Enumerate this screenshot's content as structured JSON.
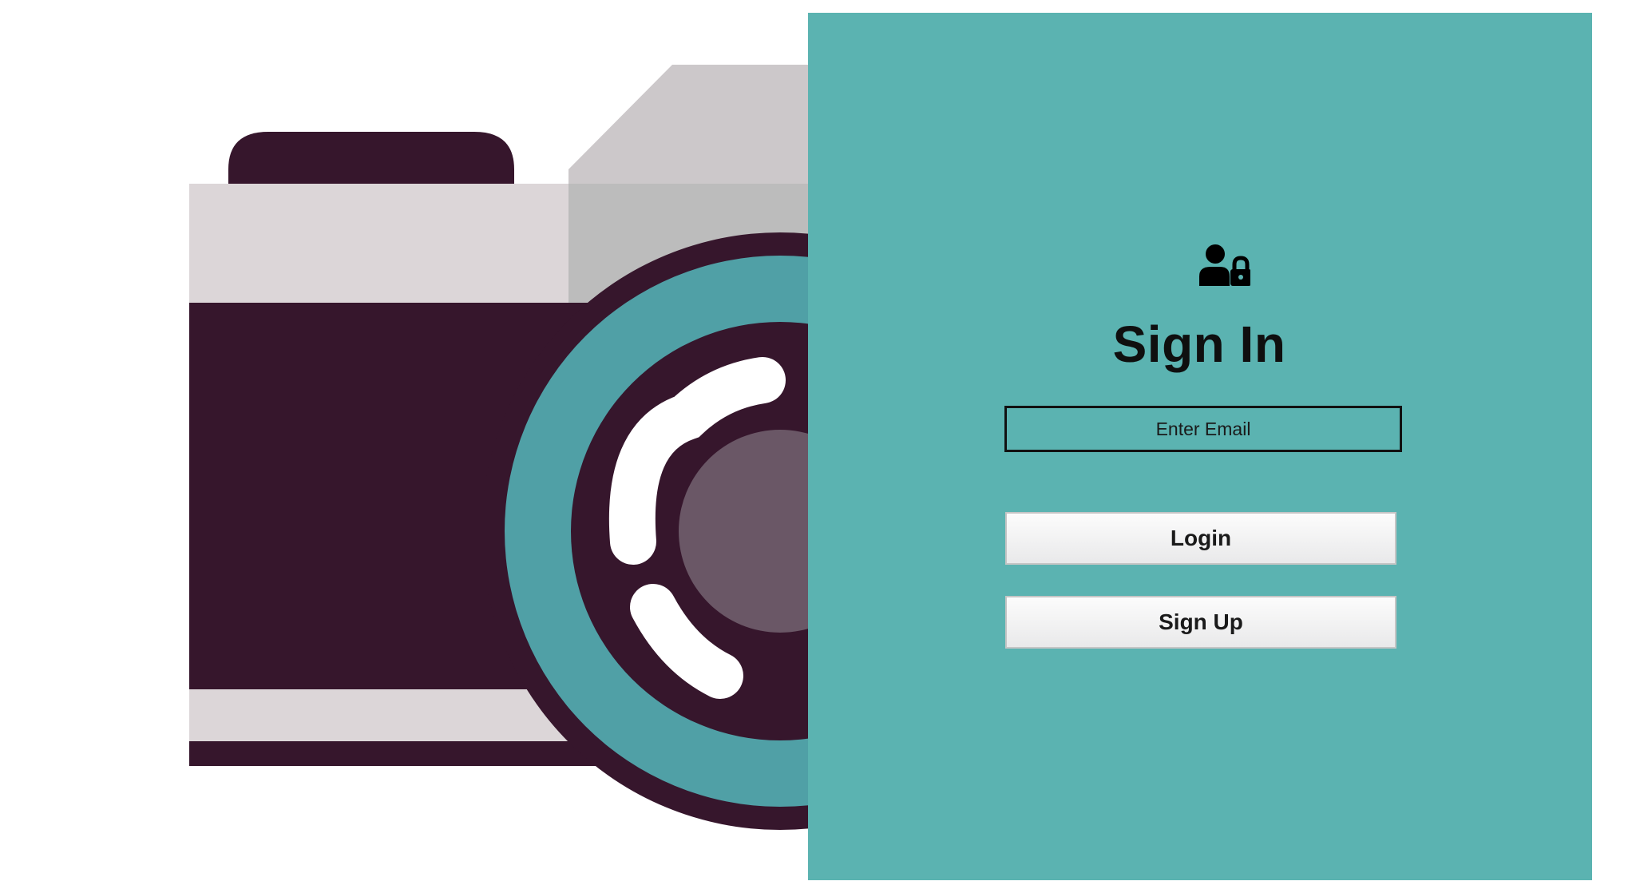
{
  "page": {
    "title": "Sign In"
  },
  "icons": {
    "header_icon": "user-lock-icon",
    "illustration": "camera-illustration"
  },
  "form": {
    "email_placeholder": "Enter Email",
    "email_value": "",
    "login_label": "Login",
    "signup_label": "Sign Up"
  },
  "colors": {
    "panel_background": "#5bb3b1",
    "camera_dark": "#36162c",
    "camera_lens_ring": "#50a0a6",
    "camera_light_body": "#dcd6d8",
    "camera_gray_top": "#ccc8ca",
    "camera_gray_mid": "#bcbcbc",
    "lens_inner": "#6a5766",
    "button_text": "#1a1a1a"
  }
}
